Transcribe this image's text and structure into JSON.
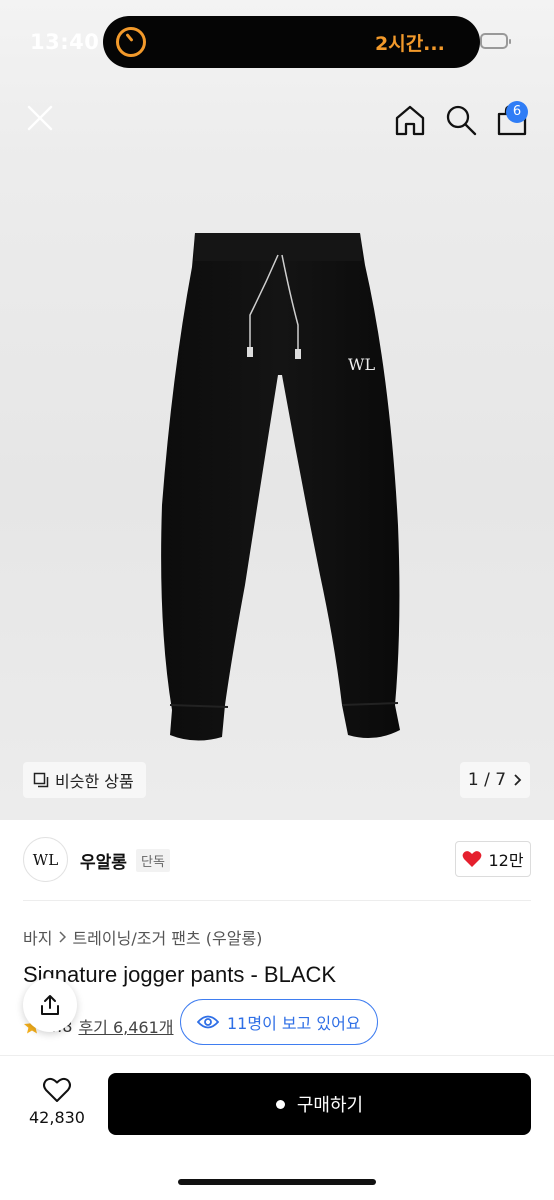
{
  "status_bar": {
    "time": "13:40",
    "activity_text": "2시간..."
  },
  "header": {
    "cart_count": "6"
  },
  "gallery": {
    "similar_label": "비슷한 상품",
    "page_indicator": "1 / 7",
    "logo_text": "WL"
  },
  "brand": {
    "name": "우알롱",
    "tag": "단독",
    "like_count": "12만",
    "logo_text": "WL"
  },
  "breadcrumb": {
    "items": [
      "바지",
      "트레이닝/조거 팬츠 (우알롱)"
    ]
  },
  "product": {
    "title": "Signature jogger pants - BLACK",
    "rating": "4.8",
    "reviews": "후기 6,461개",
    "viewers": "11명이 보고 있어요"
  },
  "bottom_bar": {
    "wish_count": "42,830",
    "buy_label": "구매하기"
  },
  "colors": {
    "accent_blue": "#2f7df6",
    "heart_red": "#e5202e",
    "timer_orange": "#f39a2b"
  },
  "icons": [
    "close-icon",
    "home-icon",
    "search-icon",
    "shopping-bag-icon",
    "similar-icon",
    "chevron-right-icon",
    "heart-icon",
    "share-icon",
    "star-icon",
    "eye-icon"
  ]
}
